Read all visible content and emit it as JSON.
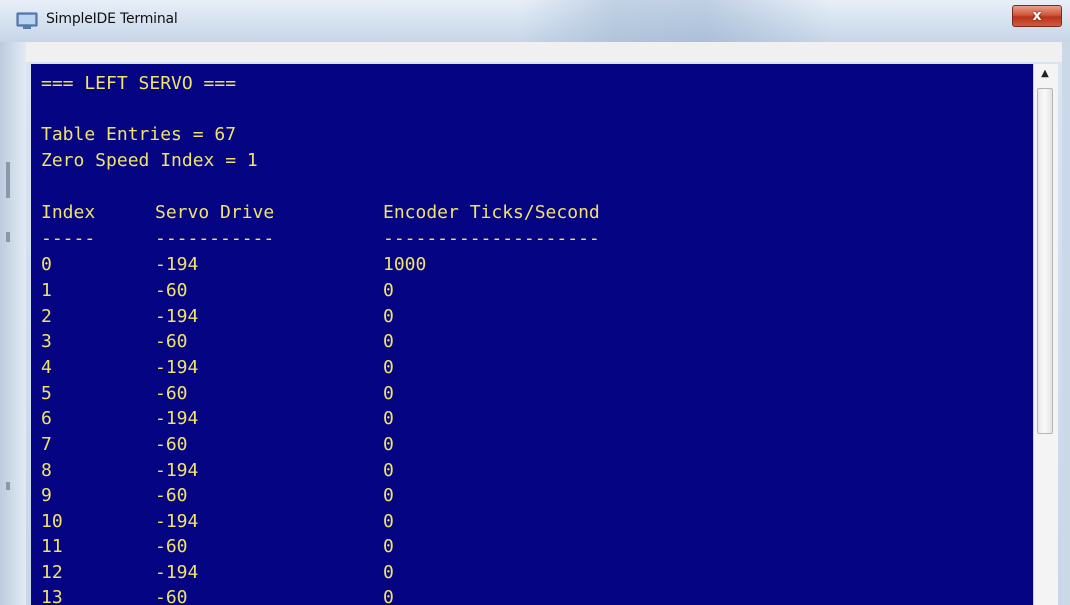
{
  "window": {
    "title": "SimpleIDE Terminal",
    "close_label": "x"
  },
  "terminal": {
    "header": "=== LEFT SERVO ===",
    "table_entries": "Table Entries = 67",
    "zero_speed_index": "Zero Speed Index = 1",
    "columns": {
      "index": "Index",
      "servo_drive": "Servo Drive",
      "encoder": "Encoder Ticks/Second"
    },
    "dividers": {
      "index": "-----",
      "servo_drive": "-----------",
      "encoder": "--------------------"
    },
    "rows": [
      {
        "index": "0",
        "drive": "-194",
        "ticks": "1000"
      },
      {
        "index": "1",
        "drive": "-60",
        "ticks": "0"
      },
      {
        "index": "2",
        "drive": "-194",
        "ticks": "0"
      },
      {
        "index": "3",
        "drive": "-60",
        "ticks": "0"
      },
      {
        "index": "4",
        "drive": "-194",
        "ticks": "0"
      },
      {
        "index": "5",
        "drive": "-60",
        "ticks": "0"
      },
      {
        "index": "6",
        "drive": "-194",
        "ticks": "0"
      },
      {
        "index": "7",
        "drive": "-60",
        "ticks": "0"
      },
      {
        "index": "8",
        "drive": "-194",
        "ticks": "0"
      },
      {
        "index": "9",
        "drive": "-60",
        "ticks": "0"
      },
      {
        "index": "10",
        "drive": "-194",
        "ticks": "0"
      },
      {
        "index": "11",
        "drive": "-60",
        "ticks": "0"
      },
      {
        "index": "12",
        "drive": "-194",
        "ticks": "0"
      },
      {
        "index": "13",
        "drive": "-60",
        "ticks": "0"
      }
    ],
    "colors": {
      "background": "#050584",
      "text": "#f1e26a"
    }
  }
}
